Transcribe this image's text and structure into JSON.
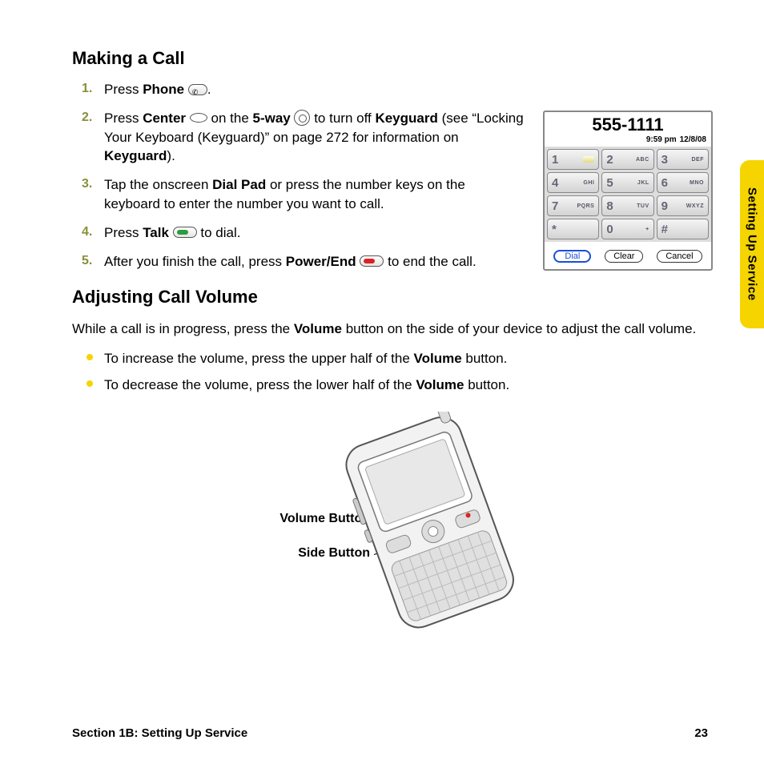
{
  "sideTab": "Setting Up Service",
  "heading1": "Making a Call",
  "steps": {
    "s1": {
      "a": "Press ",
      "b": "Phone",
      "c": "."
    },
    "s2": {
      "a": "Press ",
      "b": "Center",
      "c": " on the ",
      "d": "5-way",
      "e": " to turn off ",
      "f": "Keyguard",
      "g": " (see “Locking Your Keyboard (Keyguard)” on page 272 for information on ",
      "h": "Keyguard",
      "i": ")."
    },
    "s3": {
      "a": "Tap the onscreen ",
      "b": "Dial Pad",
      "c": " or press the number keys on the keyboard to enter the number you want to call."
    },
    "s4": {
      "a": "Press ",
      "b": "Talk",
      "c": " to dial."
    },
    "s5": {
      "a": "After you finish the call, press ",
      "b": "Power/End",
      "c": " to end the call."
    }
  },
  "heading2": "Adjusting Call Volume",
  "volIntro": {
    "a": "While a call is in progress, press the ",
    "b": "Volume",
    "c": " button on the side of your device to adjust the call volume."
  },
  "bullets": {
    "b1": {
      "a": "To increase the volume, press the upper half of the ",
      "b": "Volume",
      "c": " button."
    },
    "b2": {
      "a": "To decrease the volume, press the lower half of the ",
      "b": "Volume",
      "c": " button."
    }
  },
  "dialpad": {
    "display": "555-1111",
    "time": "9:59 pm",
    "date": "12/8/08",
    "keys": [
      {
        "d": "1",
        "l": ""
      },
      {
        "d": "2",
        "l": "ABC"
      },
      {
        "d": "3",
        "l": "DEF"
      },
      {
        "d": "4",
        "l": "GHI"
      },
      {
        "d": "5",
        "l": "JKL"
      },
      {
        "d": "6",
        "l": "MNO"
      },
      {
        "d": "7",
        "l": "PQRS"
      },
      {
        "d": "8",
        "l": "TUV"
      },
      {
        "d": "9",
        "l": "WXYZ"
      },
      {
        "d": "*",
        "l": ""
      },
      {
        "d": "0",
        "l": "+"
      },
      {
        "d": "#",
        "l": ""
      }
    ],
    "btnDial": "Dial",
    "btnClear": "Clear",
    "btnCancel": "Cancel"
  },
  "labels": {
    "volume": "Volume Button",
    "side": "Side Button"
  },
  "footer": {
    "section": "Section 1B: Setting Up Service",
    "page": "23"
  }
}
